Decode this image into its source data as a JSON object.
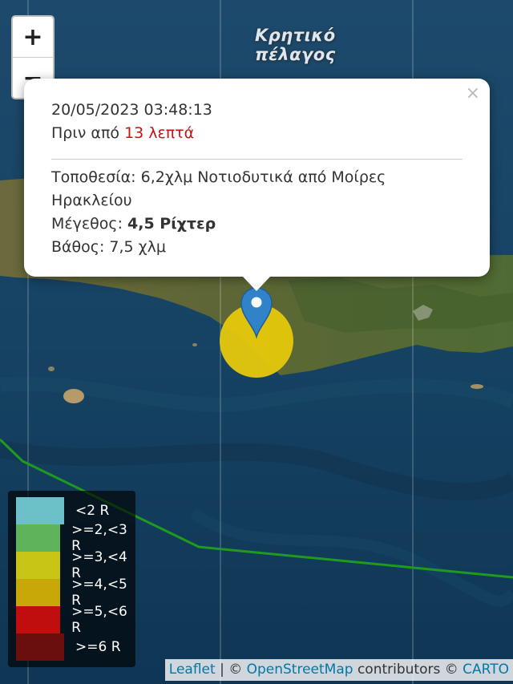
{
  "zoom": {
    "in_label": "+",
    "out_label": "−"
  },
  "sea_label": {
    "line1": "Κρητικό",
    "line2": "πέλαγος"
  },
  "popup": {
    "close": "×",
    "datetime": "20/05/2023 03:48:13",
    "ago_prefix": "Πριν από",
    "ago_value": "13 λεπτά",
    "location_label": "Τοποθεσία:",
    "location_value": "6,2χλμ Νοτιοδυτικά από Μοίρες Ηρακλείου",
    "magnitude_label": "Μέγεθος:",
    "magnitude_value": "4,5 Ρίχτερ",
    "depth_label": "Βάθος:",
    "depth_value": "7,5 χλμ"
  },
  "legend": [
    {
      "label": "<2 R",
      "color": "#6cc0c8"
    },
    {
      "label": ">=2,<3 R",
      "color": "#5fb35a"
    },
    {
      "label": ">=3,<4 R",
      "color": "#c9c516"
    },
    {
      "label": ">=4,<5 R",
      "color": "#c8a808"
    },
    {
      "label": ">=5,<6 R",
      "color": "#c00d0d"
    },
    {
      "label": ">=6 R",
      "color": "#6a0e0e"
    }
  ],
  "marker": {
    "magnitude_color": "#e6c80c",
    "pin_color": "#3083c8"
  },
  "attribution": {
    "leaflet": "Leaflet",
    "separator": "| ©",
    "osm": "OpenStreetMap",
    "contributors": "contributors ©",
    "carto": "CARTO"
  }
}
